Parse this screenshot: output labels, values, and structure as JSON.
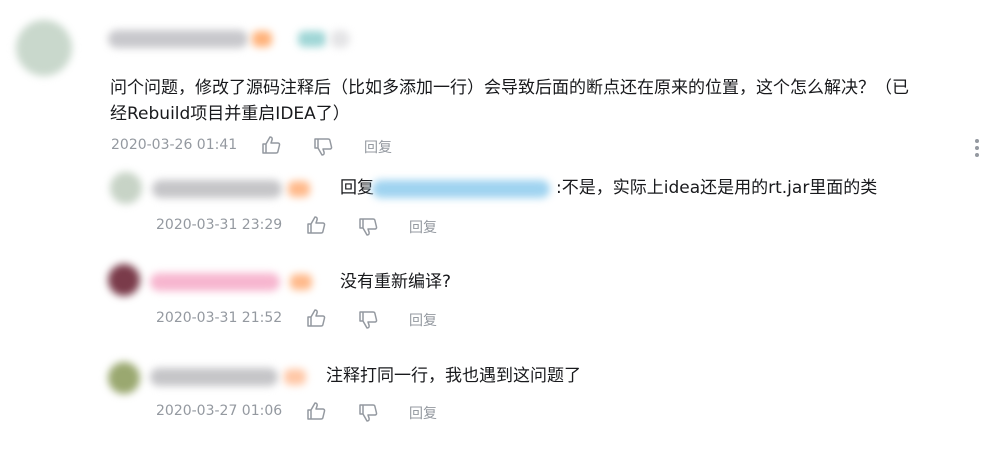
{
  "colors": {
    "text": "#18191c",
    "meta": "#9499a0",
    "redacted_link": "#9fd3f0",
    "redacted_name_pink": "#f7b6cf"
  },
  "icons": {
    "like": "thumbs-up-icon",
    "dislike": "thumbs-down-icon",
    "more": "more-vertical-icon"
  },
  "main_comment": {
    "text_line1": "问个问题，修改了源码注释后（比如多添加一行）会导致后面的断点还在原来的位置，这个怎么解决？（已",
    "text_line2": "经Rebuild项目并重启IDEA了）",
    "timestamp": "2020-03-26 01:41",
    "reply_label": "回复"
  },
  "replies": [
    {
      "prefix": "回复",
      "suffix": ":不是，实际上idea还是用的rt.jar里面的类",
      "timestamp": "2020-03-31 23:29",
      "reply_label": "回复"
    },
    {
      "text": "没有重新编译?",
      "timestamp": "2020-03-31 21:52",
      "reply_label": "回复"
    },
    {
      "text": "注释打同一行，我也遇到这问题了",
      "timestamp": "2020-03-27 01:06",
      "reply_label": "回复"
    }
  ]
}
